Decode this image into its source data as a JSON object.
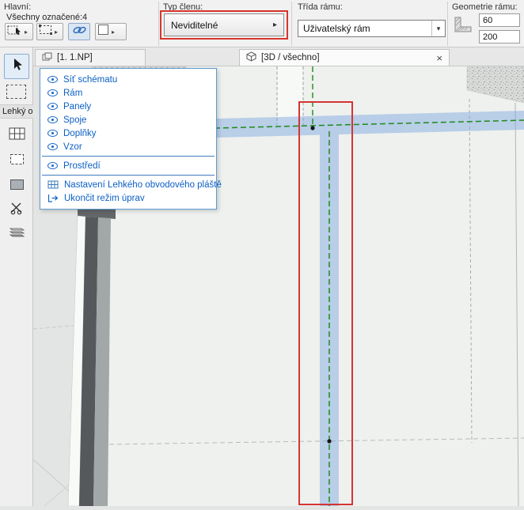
{
  "colors": {
    "accent_blue": "#0a5fc4",
    "selection_red": "#d8342c",
    "scheme_green": "#1e8a1e",
    "highlight_band_blue": "#7fa8e0",
    "toolbar_bg": "#f1f1f1",
    "viewport_bg": "#e3e5e4"
  },
  "icons": {
    "caret_right": "▸",
    "caret_down": "▾",
    "close": "×"
  },
  "toolbar": {
    "main_label": "Hlavní:",
    "selection_status": "Všechny označené:4",
    "member_type_label": "Typ členu:",
    "member_type_value": "Neviditelné",
    "frame_class_label": "Třída rámu:",
    "frame_class_value": "Uživatelský rám",
    "frame_geometry_label": "Geometrie rámu:",
    "frame_width": "60",
    "frame_height": "200"
  },
  "tabs": {
    "tab1": "[1. 1.NP]",
    "tab2": "[3D / všechno]"
  },
  "sidebar": {
    "panel_label": "Lehký ob"
  },
  "popup": {
    "items": [
      "Síť schématu",
      "Rám",
      "Panely",
      "Spoje",
      "Doplňky",
      "Vzor",
      "Prostředí",
      "Nastavení Lehkého obvodového pláště",
      "Ukončit režim úprav"
    ]
  }
}
